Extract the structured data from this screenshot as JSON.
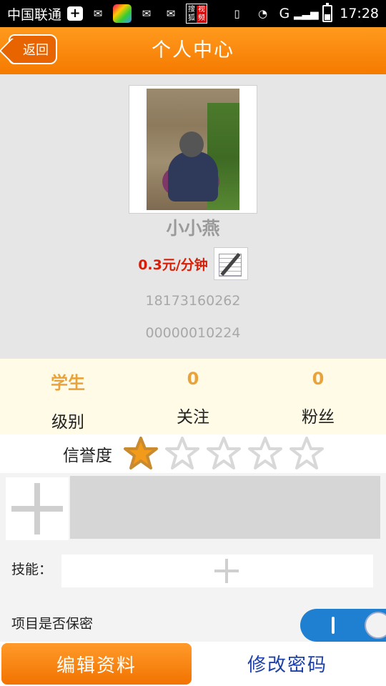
{
  "statusbar": {
    "carrier": "中国联通",
    "app_icon_text_top": "搜狐",
    "app_icon_text_bottom": "视频",
    "network": "G",
    "time": "17:28"
  },
  "header": {
    "back_label": "返回",
    "title": "个人中心"
  },
  "profile": {
    "nickname": "小小燕",
    "price": "0.3元/分钟",
    "phone": "18173160262",
    "uid": "00000010224"
  },
  "stats": [
    {
      "value": "学生",
      "label": "级别"
    },
    {
      "value": "0",
      "label": "关注"
    },
    {
      "value": "0",
      "label": "粉丝"
    }
  ],
  "credit": {
    "label": "信誉度",
    "stars_filled": 1,
    "stars_total": 5,
    "filled_color": "#f29a1a",
    "empty_color": "#d8d8d8"
  },
  "skills": {
    "label": "技能："
  },
  "secret": {
    "label": "项目是否保密",
    "toggle_state": "on"
  },
  "bottom": {
    "edit_label": "编辑资料",
    "password_label": "修改密码"
  },
  "colors": {
    "accent_orange": "#f57a00",
    "price_red": "#d81e06",
    "link_blue": "#1c3fa8",
    "toggle_blue": "#1f7fd1"
  }
}
